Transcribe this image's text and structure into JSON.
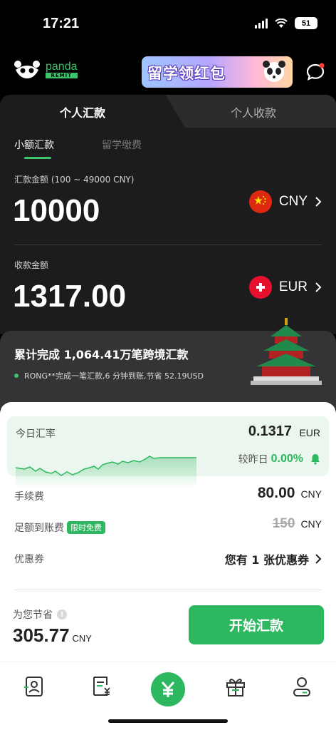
{
  "status_bar": {
    "time": "17:21",
    "battery": "51"
  },
  "header": {
    "logo_word": "panda",
    "logo_sub": "REMIT",
    "banner_text": "留学领红包"
  },
  "tabs": [
    {
      "label": "个人汇款"
    },
    {
      "label": "个人收款"
    }
  ],
  "subtabs": [
    {
      "label": "小额汇款"
    },
    {
      "label": "留学缴费"
    }
  ],
  "send": {
    "label": "汇款金额 (100 ~ 49000 CNY)",
    "amount": "10000",
    "currency": "CNY"
  },
  "receive": {
    "label": "收款金额",
    "amount": "1317.00",
    "currency": "EUR"
  },
  "stats": {
    "title": "累计完成 1,064.41万笔跨境汇款",
    "ticker": "RONG**完成一笔汇款,6 分钟到账,节省 52.19USD"
  },
  "rate": {
    "label": "今日汇率",
    "value": "0.1317",
    "currency": "EUR",
    "compare_label": "较昨日",
    "compare_value": "0.00%"
  },
  "fee": {
    "label": "手续费",
    "value": "80.00",
    "currency": "CNY"
  },
  "full_arrival": {
    "label": "足额到账费",
    "badge": "限时免费",
    "value": "150",
    "currency": "CNY"
  },
  "coupon": {
    "label": "优惠券",
    "text": "您有 1 张优惠券"
  },
  "savings": {
    "label": "为您节省",
    "value": "305.77",
    "currency": "CNY"
  },
  "cta_label": "开始汇款",
  "colors": {
    "accent": "#2db85f",
    "dark_bg": "#1c1c1e"
  }
}
